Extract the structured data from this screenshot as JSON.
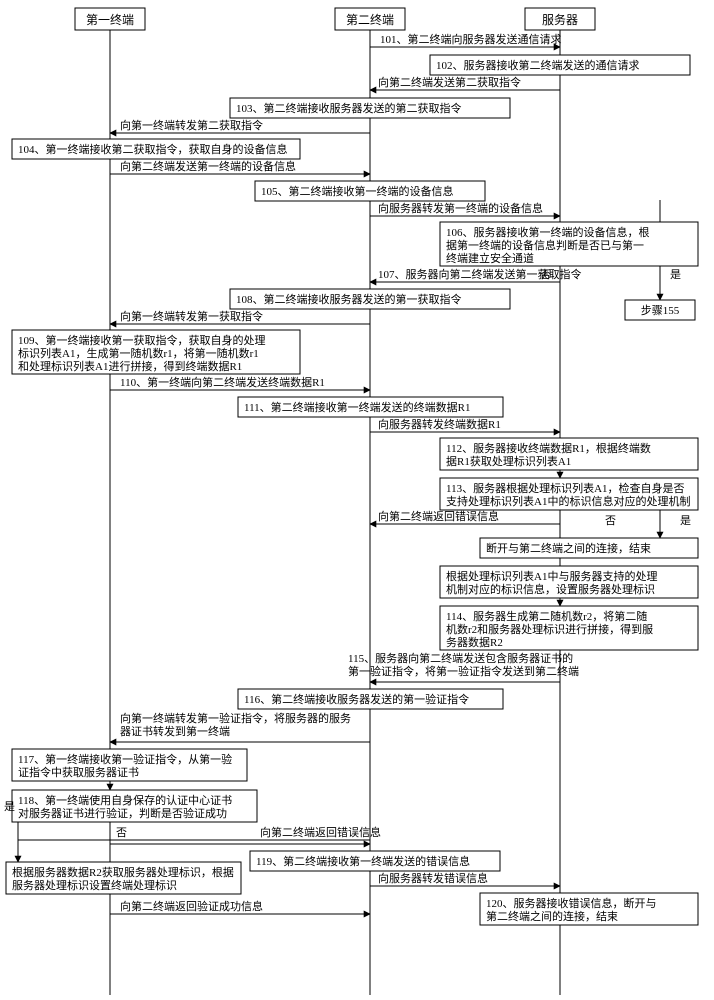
{
  "participants": {
    "p1": "第一终端",
    "p2": "第二终端",
    "p3": "服务器"
  },
  "labels": {
    "yes": "是",
    "no": "否",
    "step155": "步骤155"
  },
  "messages": {
    "m101": "101、第二终端向服务器发送通信请求",
    "m102": "102、服务器接收第二终端发送的通信请求",
    "m_send2fetch": "向第二终端发送第二获取指令",
    "m103": "103、第二终端接收服务器发送的第二获取指令",
    "m_fwd2fetch1": "向第一终端转发第二获取指令",
    "m104": "104、第一终端接收第二获取指令，获取自身的设备信息",
    "m_sendDev": "向第二终端发送第一终端的设备信息",
    "m105": "105、第二终端接收第一终端的设备信息",
    "m_fwdDev": "向服务器转发第一终端的设备信息",
    "m106": "106、服务器接收第一终端的设备信息，根据第一终端的设备信息判断是否已与第一终端建立安全通道",
    "m107": "107、服务器向第二终端发送第一获取指令",
    "m108": "108、第二终端接收服务器发送的第一获取指令",
    "m_fwd1fetch1": "向第一终端转发第一获取指令",
    "m109": "109、第一终端接收第一获取指令，获取自身的处理标识列表A1，生成第一随机数r1，将第一随机数r1和处理标识列表A1进行拼接，得到终端数据R1",
    "m110": "110、第一终端向第二终端发送终端数据R1",
    "m111": "111、第二终端接收第一终端发送的终端数据R1",
    "m_fwdR1": "向服务器转发终端数据R1",
    "m112": "112、服务器接收终端数据R1，根据终端数据R1获取处理标识列表A1",
    "m113": "113、服务器根据处理标识列表A1，检查自身是否支持处理标识列表A1中的标识信息对应的处理机制",
    "m_retErr2": "向第二终端返回错误信息",
    "m_disc2": "断开与第二终端之间的连接，结束",
    "m_setId": "根据处理标识列表A1中与服务器支持的处理机制对应的标识信息，设置服务器处理标识",
    "m114": "114、服务器生成第二随机数r2，将第二随机数r2和服务器处理标识进行拼接，得到服务器数据R2",
    "m115": "115、服务器向第二终端发送包含服务器证书的第一验证指令，将第一验证指令发送到第二终端",
    "m116": "116、第二终端接收服务器发送的第一验证指令",
    "m_fwdVer1": "向第一终端转发第一验证指令，将服务器的服务器证书转发到第一终端",
    "m117": "117、第一终端接收第一验证指令，从第一验证指令中获取服务器证书",
    "m118": "118、第一终端使用自身保存的认证中心证书对服务器证书进行验证，判断是否验证成功",
    "m_setTid": "根据服务器数据R2获取服务器处理标识，根据服务器处理标识设置终端处理标识",
    "m_retErr2b": "向第二终端返回错误信息",
    "m119": "119、第二终端接收第一终端发送的错误信息",
    "m_fwdErr": "向服务器转发错误信息",
    "m120": "120、服务器接收错误信息，断开与第二终端之间的连接，结束",
    "m_retOK2": "向第二终端返回验证成功信息"
  }
}
